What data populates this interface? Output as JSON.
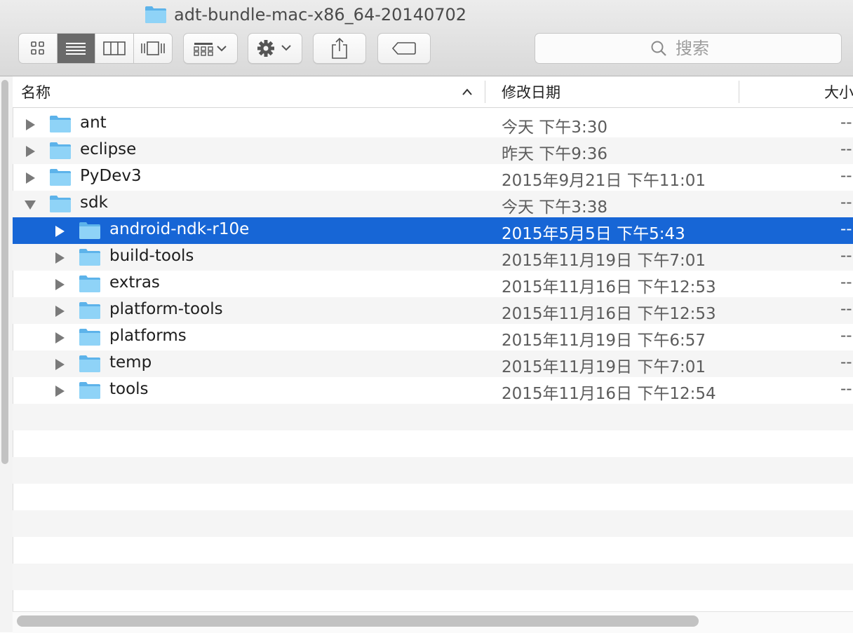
{
  "window": {
    "title": "adt-bundle-mac-x86_64-20140702"
  },
  "toolbar": {
    "view_modes": [
      "icon-view",
      "list-view",
      "column-view",
      "cover-flow-view"
    ],
    "active_view": "list-view",
    "search_placeholder": "搜索"
  },
  "columns": {
    "name": "名称",
    "date": "修改日期",
    "size": "大小"
  },
  "colors": {
    "selection": "#1766d6",
    "folder": "#6fc3f2"
  },
  "rows": [
    {
      "name": "ant",
      "date": "今天 下午3:30",
      "size": "--",
      "level": 0,
      "expanded": false,
      "selected": false
    },
    {
      "name": "eclipse",
      "date": "昨天 下午9:36",
      "size": "--",
      "level": 0,
      "expanded": false,
      "selected": false
    },
    {
      "name": "PyDev3",
      "date": "2015年9月21日 下午11:01",
      "size": "--",
      "level": 0,
      "expanded": false,
      "selected": false
    },
    {
      "name": "sdk",
      "date": "今天 下午3:38",
      "size": "--",
      "level": 0,
      "expanded": true,
      "selected": false
    },
    {
      "name": "android-ndk-r10e",
      "date": "2015年5月5日 下午5:43",
      "size": "--",
      "level": 1,
      "expanded": false,
      "selected": true
    },
    {
      "name": "build-tools",
      "date": "2015年11月19日 下午7:01",
      "size": "--",
      "level": 1,
      "expanded": false,
      "selected": false
    },
    {
      "name": "extras",
      "date": "2015年11月16日 下午12:53",
      "size": "--",
      "level": 1,
      "expanded": false,
      "selected": false
    },
    {
      "name": "platform-tools",
      "date": "2015年11月16日 下午12:53",
      "size": "--",
      "level": 1,
      "expanded": false,
      "selected": false
    },
    {
      "name": "platforms",
      "date": "2015年11月19日 下午6:57",
      "size": "--",
      "level": 1,
      "expanded": false,
      "selected": false
    },
    {
      "name": "temp",
      "date": "2015年11月19日 下午7:01",
      "size": "--",
      "level": 1,
      "expanded": false,
      "selected": false
    },
    {
      "name": "tools",
      "date": "2015年11月16日 下午12:54",
      "size": "--",
      "level": 1,
      "expanded": false,
      "selected": false
    }
  ]
}
